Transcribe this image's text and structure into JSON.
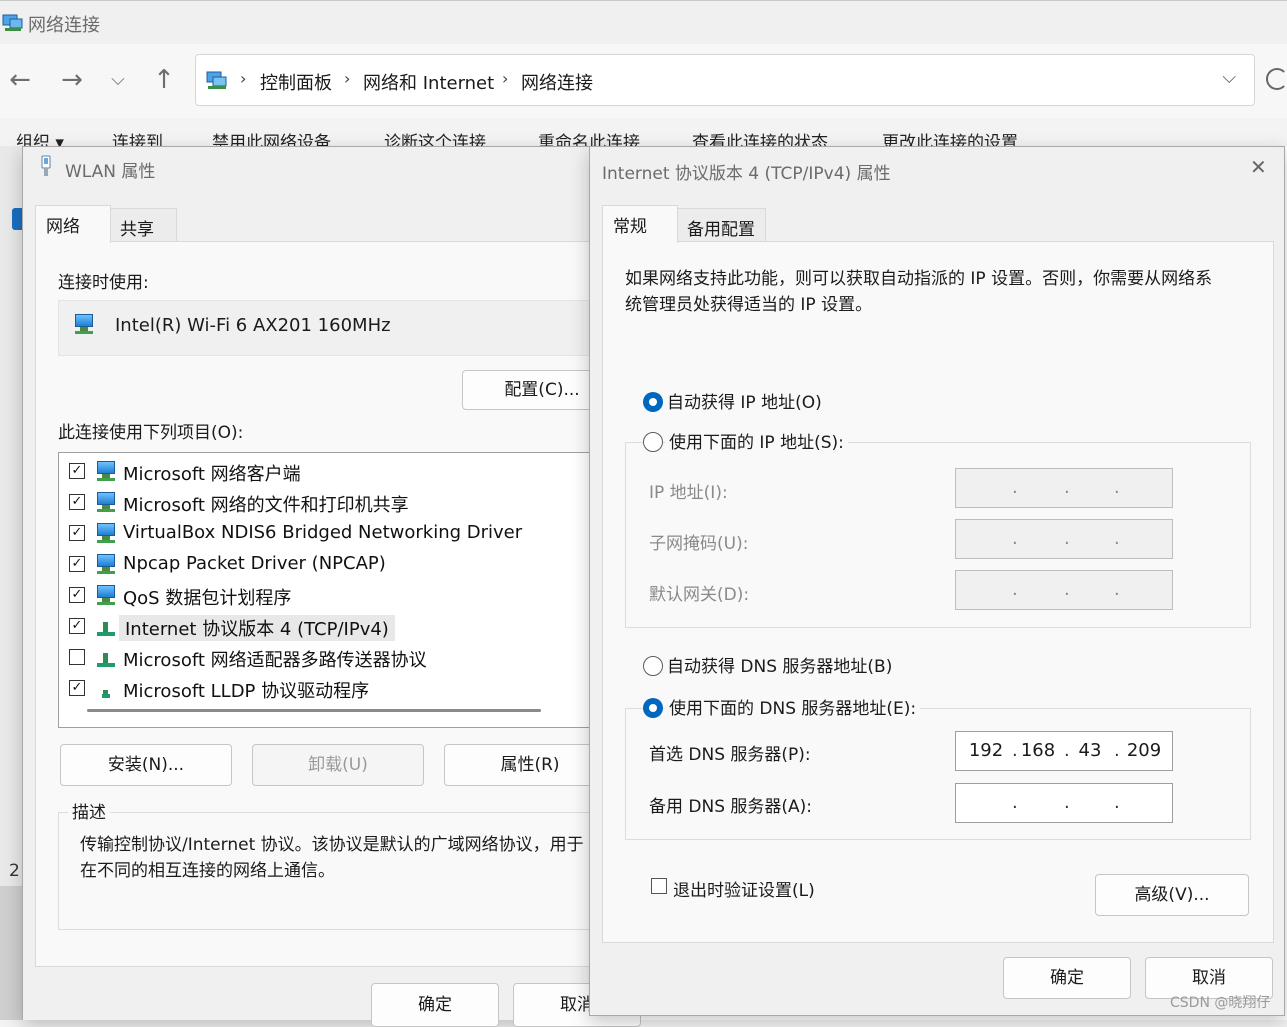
{
  "explorer": {
    "title": "网络连接",
    "address": {
      "crumbs": [
        "控制面板",
        "网络和 Internet",
        "网络连接"
      ]
    },
    "commands": [
      "组织 ▾",
      "连接到",
      "禁用此网络设备",
      "诊断这个连接",
      "重命名此连接",
      "查看此连接的状态",
      "更改此连接的设置"
    ],
    "left_number": "2"
  },
  "wlan_dialog": {
    "title": "WLAN 属性",
    "tabs": [
      "网络",
      "共享"
    ],
    "connect_using_label": "连接时使用:",
    "adapter_name": "Intel(R) Wi-Fi 6 AX201 160MHz",
    "configure_button": "配置(C)...",
    "items_label": "此连接使用下列项目(O):",
    "items": [
      {
        "checked": true,
        "label": "Microsoft 网络客户端",
        "icon": "network-client-icon"
      },
      {
        "checked": true,
        "label": "Microsoft 网络的文件和打印机共享",
        "icon": "network-service-icon"
      },
      {
        "checked": true,
        "label": "VirtualBox NDIS6 Bridged Networking Driver",
        "icon": "network-service-icon"
      },
      {
        "checked": true,
        "label": "Npcap Packet Driver (NPCAP)",
        "icon": "network-service-icon"
      },
      {
        "checked": true,
        "label": "QoS 数据包计划程序",
        "icon": "network-service-icon"
      },
      {
        "checked": true,
        "label": "Internet 协议版本 4 (TCP/IPv4)",
        "icon": "protocol-icon",
        "selected": true
      },
      {
        "checked": false,
        "label": "Microsoft 网络适配器多路传送器协议",
        "icon": "protocol-icon"
      },
      {
        "checked": true,
        "label": "Microsoft LLDP 协议驱动程序",
        "icon": "protocol-icon"
      }
    ],
    "install_button": "安装(N)...",
    "uninstall_button": "卸载(U)",
    "properties_button": "属性(R)",
    "description_label": "描述",
    "description_text": "传输控制协议/Internet 协议。该协议是默认的广域网络协议，用于在不同的相互连接的网络上通信。",
    "ok_button": "确定",
    "cancel_button": "取消"
  },
  "ipv4_dialog": {
    "title": "Internet 协议版本 4 (TCP/IPv4) 属性",
    "close_glyph": "✕",
    "tabs": [
      "常规",
      "备用配置"
    ],
    "intro_text": "如果网络支持此功能，则可以获取自动指派的 IP 设置。否则，你需要从网络系统管理员处获得适当的 IP 设置。",
    "auto_ip_radio": "自动获得 IP 地址(O)",
    "manual_ip_radio": "使用下面的 IP 地址(S):",
    "ip_address_label": "IP 地址(I):",
    "subnet_label": "子网掩码(U):",
    "gateway_label": "默认网关(D):",
    "auto_dns_radio": "自动获得 DNS 服务器地址(B)",
    "manual_dns_radio": "使用下面的 DNS 服务器地址(E):",
    "preferred_dns_label": "首选 DNS 服务器(P):",
    "preferred_dns_value": [
      "192",
      "168",
      "43",
      "209"
    ],
    "alternate_dns_label": "备用 DNS 服务器(A):",
    "alternate_dns_value": [
      "",
      "",
      "",
      ""
    ],
    "validate_checkbox": "退出时验证设置(L)",
    "advanced_button": "高级(V)...",
    "ok_button": "确定",
    "cancel_button": "取消",
    "selected_ip_mode": "auto",
    "selected_dns_mode": "manual"
  },
  "watermark": "CSDN @晓翔仔",
  "colors": {
    "accent": "#0067c0",
    "dialog_bg": "#f0f0f0",
    "panel_bg": "#f9f9f9"
  }
}
